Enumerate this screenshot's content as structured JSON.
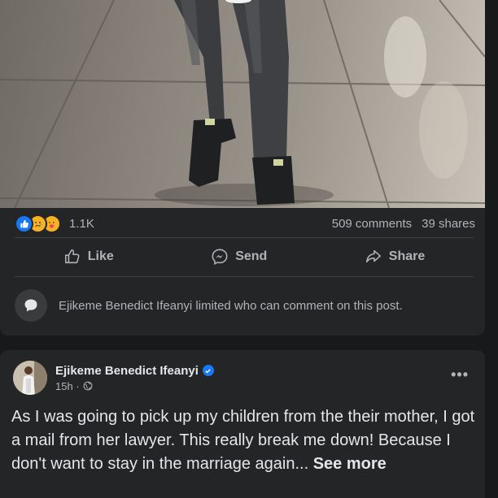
{
  "post1": {
    "reactions": {
      "icons": [
        "like-icon",
        "sad-icon",
        "love-icon"
      ],
      "count": "1.1K"
    },
    "comments": "509 comments",
    "shares": "39 shares",
    "actions": {
      "like": "Like",
      "send": "Send",
      "share": "Share"
    },
    "limit_notice": "Ejikeme Benedict Ifeanyi limited who can comment on this post."
  },
  "post2": {
    "author": "Ejikeme Benedict Ifeanyi",
    "time": "15h · ",
    "text": "As I was going to pick up my children from the their mother, I got a mail from her lawyer. This really break me down! Because I don't want to stay in the marriage again... ",
    "see_more": "See more"
  },
  "colors": {
    "background": "#18191a",
    "card": "#242526",
    "accent": "#1877f2",
    "secondary_text": "#b0b3b8"
  }
}
